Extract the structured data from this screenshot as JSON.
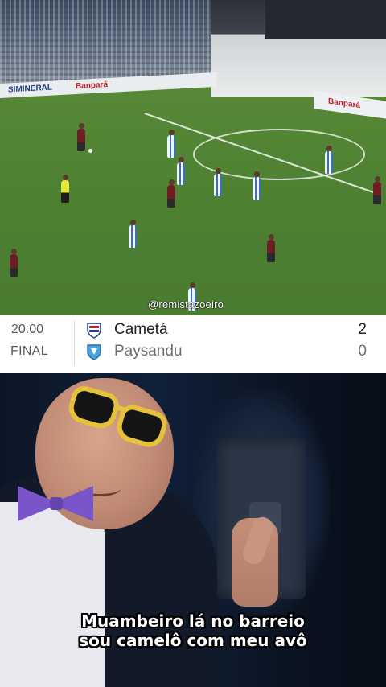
{
  "video": {
    "watermark": "@remistazoeiro",
    "ads": {
      "left_brand": "SIMINERAL",
      "left_bank": "Banpará",
      "right_bank": "Banpará"
    }
  },
  "match": {
    "time": "20:00",
    "status": "FINAL",
    "home": {
      "name": "Cametá",
      "score": "2",
      "crest_color": "#c0212c"
    },
    "away": {
      "name": "Paysandu",
      "score": "0",
      "crest_color": "#4aa3d8"
    }
  },
  "meme": {
    "caption_line1": "Muambeiro lá no barreio",
    "caption_line2": "sou camelô com meu avô"
  }
}
